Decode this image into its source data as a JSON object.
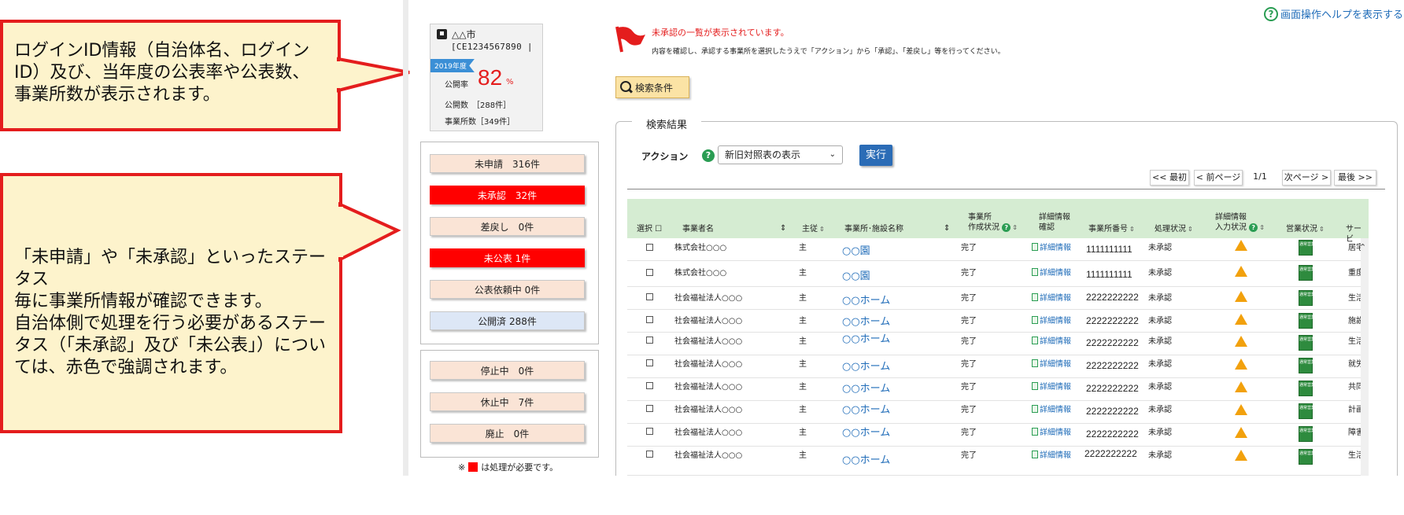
{
  "callouts": {
    "login_info": "ログインID情報（自治体名、ログイン\nID）及び、当年度の公表率や公表数、\n事業所数が表示されます。",
    "status_info": "「未申請」や「未承認」といったステータス\n毎に事業所情報が確認できます。\n自治体側で処理を行う必要があるステー\nタス（「未承認」及び「未公表」）につい\nては、赤色で強調されます。"
  },
  "login": {
    "city": "△△市",
    "login_id": "[CE1234567890  |",
    "year": "2019年度",
    "rate_label": "公開率",
    "rate_value": "82",
    "rate_unit": "%",
    "public_count": "公開数　［288件］",
    "office_count": "事業所数［349件］"
  },
  "status_groups": [
    [
      {
        "label": "未申請　316件",
        "highlight": false
      },
      {
        "label": "未承認　32件",
        "highlight": true
      },
      {
        "label": "差戻し　0件",
        "highlight": false
      },
      {
        "label": "未公表 1件",
        "highlight": true
      },
      {
        "label": "公表依頼中 0件",
        "highlight": false
      },
      {
        "label": "公開済 288件",
        "highlight": false
      }
    ],
    [
      {
        "label": "停止中　0件",
        "highlight": false
      },
      {
        "label": "休止中　7件",
        "highlight": false
      },
      {
        "label": "廃止　0件",
        "highlight": false
      }
    ]
  ],
  "note": {
    "prefix": "※",
    "text": "は処理が必要です。"
  },
  "header": {
    "help": "画面操作ヘルプを表示する",
    "message_title": "未承認の一覧が表示されています。",
    "message_body": "内容を確認し、承認する事業所を選択したうえで「アクション」から「承認」、「差戻し」等を行ってください。",
    "search_button": "検索条件"
  },
  "results": {
    "legend": "検索結果",
    "action_label": "アクション",
    "action_selected": "新旧対照表の表示",
    "execute": "実行",
    "pager": {
      "first": "<< 最初",
      "prev": "< 前ページ",
      "page": "1/1",
      "next": "次ページ >",
      "last": "最後 >>"
    }
  },
  "table": {
    "headers": {
      "select": "選択 ☐",
      "operator": "事業者名",
      "main_sub": "主従",
      "facility": "事業所･施設名称",
      "status_line1": "事業所",
      "status_line2": "作成状況",
      "detail_line1": "詳細情報",
      "detail_line2": "確認",
      "office_no": "事業所番号",
      "process": "処理状況",
      "input_line1": "詳細情報",
      "input_line2": "入力状況",
      "business": "営業状況",
      "service": "サービ"
    },
    "rows": [
      {
        "operator": "株式会社○○○",
        "main": "主",
        "facility": "○○園",
        "status": "完了",
        "detail": "詳細情報",
        "number": "1111111111",
        "process": "未承認",
        "service": "居宅"
      },
      {
        "operator": "株式会社○○○",
        "main": "主",
        "facility": "○○園",
        "status": "完了",
        "detail": "詳細情報",
        "number": "1111111111",
        "process": "未承認",
        "service": "重度"
      },
      {
        "operator": "社会福祉法人○○○",
        "main": "主",
        "facility": "○○ホーム",
        "status": "完了",
        "detail": "詳細情報",
        "number": "2222222222",
        "process": "未承認",
        "service": "生活"
      },
      {
        "operator": "社会福祉法人○○○",
        "main": "主",
        "facility": "○○ホーム",
        "status": "完了",
        "detail": "詳細情報",
        "number": "2222222222",
        "process": "未承認",
        "service": "施設"
      },
      {
        "operator": "社会福祉法人○○○",
        "main": "主",
        "facility": "○○ホーム",
        "status": "完了",
        "detail": "詳細情報",
        "number": "2222222222",
        "process": "未承認",
        "service": "生活"
      },
      {
        "operator": "社会福祉法人○○○",
        "main": "主",
        "facility": "○○ホーム",
        "status": "完了",
        "detail": "詳細情報",
        "number": "2222222222",
        "process": "未承認",
        "service": "就労"
      },
      {
        "operator": "社会福祉法人○○○",
        "main": "主",
        "facility": "○○ホーム",
        "status": "完了",
        "detail": "詳細情報",
        "number": "2222222222",
        "process": "未承認",
        "service": "共同"
      },
      {
        "operator": "社会福祉法人○○○",
        "main": "主",
        "facility": "○○ホーム",
        "status": "完了",
        "detail": "詳細情報",
        "number": "2222222222",
        "process": "未承認",
        "service": "計画"
      },
      {
        "operator": "社会福祉法人○○○",
        "main": "主",
        "facility": "○○ホーム",
        "status": "完了",
        "detail": "詳細情報",
        "number": "2222222222",
        "process": "未承認",
        "service": "障害"
      },
      {
        "operator": "社会福祉法人○○○",
        "main": "主",
        "facility": "○○ホーム",
        "status": "完了",
        "detail": "詳細情報",
        "number": "2222222222",
        "process": "未承認",
        "service": "生活"
      }
    ],
    "business_icon_text": "通常営業"
  },
  "colors": {
    "alert": "#ff0000",
    "callout_border": "#e41d1d",
    "callout_fill": "#fdf3cc",
    "link": "#1e6bb8",
    "header_green": "#d5ecd2",
    "execute_blue": "#2b6cb6"
  }
}
